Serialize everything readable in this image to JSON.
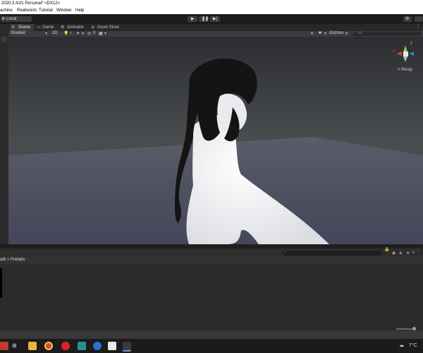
{
  "window": {
    "title": "2020.3.41f1 Personal* <DX12>"
  },
  "menu": {
    "items": [
      "achine",
      "Reallusion",
      "Tutorial",
      "Window",
      "Help"
    ]
  },
  "toolbar": {
    "pivot_label": "Local"
  },
  "tabs": [
    {
      "label": "Scene",
      "active": true
    },
    {
      "label": "Game",
      "active": false
    },
    {
      "label": "Animator",
      "active": false
    },
    {
      "label": "Asset Store",
      "active": false
    }
  ],
  "scene_toolbar": {
    "shading_mode": "Shaded",
    "mode_2d": "2D",
    "hidden_count": "0",
    "gizmos_label": "Gizmos",
    "search_placeholder": "All"
  },
  "gizmo": {
    "y_label": "y",
    "x_label": "x",
    "projection_label": "< Persp"
  },
  "project": {
    "breadcrumb": "ai8 > Prefabs",
    "hidden_count": "8"
  },
  "taskbar": {
    "temperature": "7°C"
  },
  "colors": {
    "accent": "#3a79bb",
    "gizmo_x": "#d6402a",
    "gizmo_y": "#8ad14a",
    "gizmo_z": "#3a79d6"
  }
}
